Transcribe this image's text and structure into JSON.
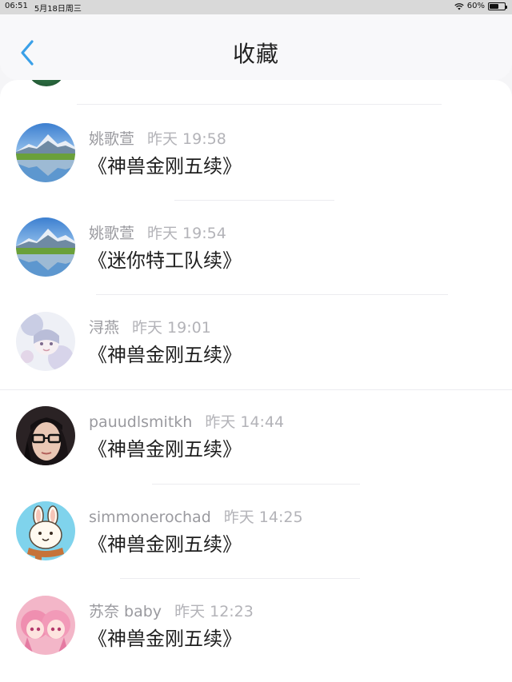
{
  "status_bar": {
    "time": "06:51",
    "date": "5月18日周三",
    "battery": "60%",
    "battery_level": 0.6
  },
  "header": {
    "title": "收藏",
    "back_icon": "chevron-left-icon",
    "accent_color": "#3aa0e8"
  },
  "items": [
    {
      "name": "姚歌萱",
      "time": "昨天 19:58",
      "message": "《神兽金刚五续》",
      "avatar": "mountain-lake-avatar"
    },
    {
      "name": "姚歌萱",
      "time": "昨天 19:54",
      "message": "《迷你特工队续》",
      "avatar": "mountain-lake-avatar"
    },
    {
      "name": "浔燕",
      "time": "昨天 19:01",
      "message": "《神兽金刚五续》",
      "avatar": "anime-girl-pastel-avatar"
    },
    {
      "name": "pauudlsmitkh",
      "time": "昨天 14:44",
      "message": "《神兽金刚五续》",
      "avatar": "woman-glasses-avatar"
    },
    {
      "name": "simmonerochad",
      "time": "昨天 14:25",
      "message": "《神兽金刚五续》",
      "avatar": "cartoon-bunny-avatar"
    },
    {
      "name": "苏奈 baby",
      "time": "昨天 12:23",
      "message": "《神兽金刚五续》",
      "avatar": "anime-twins-pink-avatar"
    }
  ]
}
